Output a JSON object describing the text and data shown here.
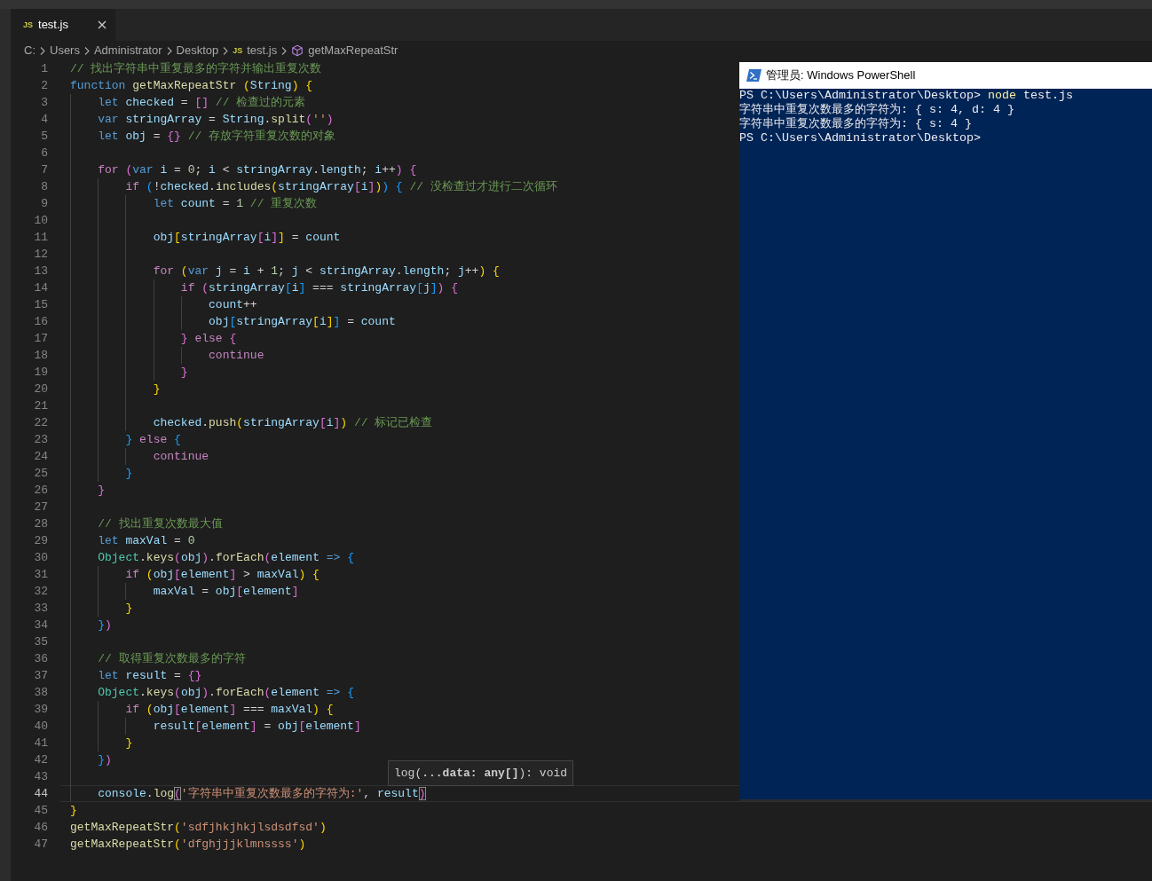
{
  "tabs": [
    {
      "icon_label": "JS",
      "label": "test.js",
      "selected": true
    }
  ],
  "breadcrumbs": [
    {
      "kind": "folder",
      "label": "C:"
    },
    {
      "kind": "folder",
      "label": "Users"
    },
    {
      "kind": "folder",
      "label": "Administrator"
    },
    {
      "kind": "folder",
      "label": "Desktop"
    },
    {
      "kind": "file",
      "icon_label": "JS",
      "label": "test.js"
    },
    {
      "kind": "symbol",
      "label": "getMaxRepeatStr"
    }
  ],
  "editor": {
    "lines": [
      {
        "number": "1",
        "current": false,
        "tokens": [
          {
            "text": "// 找出字符串中重复最多的字符并输出重复次数",
            "kind": "comment"
          }
        ]
      },
      {
        "number": "2",
        "current": false,
        "tokens": [
          {
            "text": "function",
            "kind": "keyword"
          },
          {
            "text": " getMaxRepeatStr",
            "kind": "function"
          },
          {
            "text": " (",
            "kind": "bracket1"
          },
          {
            "text": "String",
            "kind": "variable"
          },
          {
            "text": ")",
            "kind": "bracket1"
          },
          {
            "text": " {",
            "kind": "bracket1"
          }
        ]
      },
      {
        "number": "3",
        "current": false,
        "tokens": [
          {
            "text": "    let",
            "kind": "keyword"
          },
          {
            "text": " checked",
            "kind": "variable"
          },
          {
            "text": " = ",
            "kind": "plain"
          },
          {
            "text": "[]",
            "kind": "bracket2"
          },
          {
            "text": " // 检查过的元素",
            "kind": "comment"
          }
        ]
      },
      {
        "number": "4",
        "current": false,
        "tokens": [
          {
            "text": "    var",
            "kind": "keyword"
          },
          {
            "text": " stringArray",
            "kind": "variable"
          },
          {
            "text": " = ",
            "kind": "plain"
          },
          {
            "text": "String",
            "kind": "variable"
          },
          {
            "text": ".",
            "kind": "plain"
          },
          {
            "text": "split",
            "kind": "function"
          },
          {
            "text": "(",
            "kind": "bracket2"
          },
          {
            "text": "''",
            "kind": "string"
          },
          {
            "text": ")",
            "kind": "bracket2"
          }
        ]
      },
      {
        "number": "5",
        "current": false,
        "tokens": [
          {
            "text": "    let",
            "kind": "keyword"
          },
          {
            "text": " obj",
            "kind": "variable"
          },
          {
            "text": " = ",
            "kind": "plain"
          },
          {
            "text": "{}",
            "kind": "bracket2"
          },
          {
            "text": " // 存放字符重复次数的对象",
            "kind": "comment"
          }
        ]
      },
      {
        "number": "6",
        "current": false
      },
      {
        "number": "7",
        "current": false,
        "tokens": [
          {
            "text": "    for",
            "kind": "control"
          },
          {
            "text": " (",
            "kind": "bracket2"
          },
          {
            "text": "var",
            "kind": "keyword"
          },
          {
            "text": " i",
            "kind": "variable"
          },
          {
            "text": " = ",
            "kind": "plain"
          },
          {
            "text": "0",
            "kind": "number"
          },
          {
            "text": "; ",
            "kind": "plain"
          },
          {
            "text": "i",
            "kind": "variable"
          },
          {
            "text": " < ",
            "kind": "plain"
          },
          {
            "text": "stringArray",
            "kind": "variable"
          },
          {
            "text": ".",
            "kind": "plain"
          },
          {
            "text": "length",
            "kind": "variable"
          },
          {
            "text": "; ",
            "kind": "plain"
          },
          {
            "text": "i",
            "kind": "variable"
          },
          {
            "text": "++",
            "kind": "plain"
          },
          {
            "text": ")",
            "kind": "bracket2"
          },
          {
            "text": " {",
            "kind": "bracket2"
          }
        ]
      },
      {
        "number": "8",
        "current": false,
        "tokens": [
          {
            "text": "        if",
            "kind": "control"
          },
          {
            "text": " (",
            "kind": "bracket3"
          },
          {
            "text": "!",
            "kind": "plain"
          },
          {
            "text": "checked",
            "kind": "variable"
          },
          {
            "text": ".",
            "kind": "plain"
          },
          {
            "text": "includes",
            "kind": "function"
          },
          {
            "text": "(",
            "kind": "bracket1"
          },
          {
            "text": "stringArray",
            "kind": "variable"
          },
          {
            "text": "[",
            "kind": "bracket2"
          },
          {
            "text": "i",
            "kind": "variable"
          },
          {
            "text": "]",
            "kind": "bracket2"
          },
          {
            "text": ")",
            "kind": "bracket1"
          },
          {
            "text": ")",
            "kind": "bracket3"
          },
          {
            "text": " {",
            "kind": "bracket3"
          },
          {
            "text": " // 没检查过才进行二次循环",
            "kind": "comment"
          }
        ]
      },
      {
        "number": "9",
        "current": false,
        "tokens": [
          {
            "text": "            let",
            "kind": "keyword"
          },
          {
            "text": " count",
            "kind": "variable"
          },
          {
            "text": " = ",
            "kind": "plain"
          },
          {
            "text": "1",
            "kind": "number"
          },
          {
            "text": " // 重复次数",
            "kind": "comment"
          }
        ]
      },
      {
        "number": "10",
        "current": false
      },
      {
        "number": "11",
        "current": false,
        "tokens": [
          {
            "text": "            obj",
            "kind": "variable"
          },
          {
            "text": "[",
            "kind": "bracket1"
          },
          {
            "text": "stringArray",
            "kind": "variable"
          },
          {
            "text": "[",
            "kind": "bracket2"
          },
          {
            "text": "i",
            "kind": "variable"
          },
          {
            "text": "]",
            "kind": "bracket2"
          },
          {
            "text": "]",
            "kind": "bracket1"
          },
          {
            "text": " = ",
            "kind": "plain"
          },
          {
            "text": "count",
            "kind": "variable"
          }
        ]
      },
      {
        "number": "12",
        "current": false
      },
      {
        "number": "13",
        "current": false,
        "tokens": [
          {
            "text": "            for",
            "kind": "control"
          },
          {
            "text": " (",
            "kind": "bracket1"
          },
          {
            "text": "var",
            "kind": "keyword"
          },
          {
            "text": " j",
            "kind": "variable"
          },
          {
            "text": " = ",
            "kind": "plain"
          },
          {
            "text": "i",
            "kind": "variable"
          },
          {
            "text": " + ",
            "kind": "plain"
          },
          {
            "text": "1",
            "kind": "number"
          },
          {
            "text": "; ",
            "kind": "plain"
          },
          {
            "text": "j",
            "kind": "variable"
          },
          {
            "text": " < ",
            "kind": "plain"
          },
          {
            "text": "stringArray",
            "kind": "variable"
          },
          {
            "text": ".",
            "kind": "plain"
          },
          {
            "text": "length",
            "kind": "variable"
          },
          {
            "text": "; ",
            "kind": "plain"
          },
          {
            "text": "j",
            "kind": "variable"
          },
          {
            "text": "++",
            "kind": "plain"
          },
          {
            "text": ")",
            "kind": "bracket1"
          },
          {
            "text": " {",
            "kind": "bracket1"
          }
        ]
      },
      {
        "number": "14",
        "current": false,
        "tokens": [
          {
            "text": "                if",
            "kind": "control"
          },
          {
            "text": " (",
            "kind": "bracket2"
          },
          {
            "text": "stringArray",
            "kind": "variable"
          },
          {
            "text": "[",
            "kind": "bracket3"
          },
          {
            "text": "i",
            "kind": "variable"
          },
          {
            "text": "]",
            "kind": "bracket3"
          },
          {
            "text": " === ",
            "kind": "plain"
          },
          {
            "text": "stringArray",
            "kind": "variable"
          },
          {
            "text": "[",
            "kind": "bracket3"
          },
          {
            "text": "j",
            "kind": "variable"
          },
          {
            "text": "]",
            "kind": "bracket3"
          },
          {
            "text": ")",
            "kind": "bracket2"
          },
          {
            "text": " {",
            "kind": "bracket2"
          }
        ]
      },
      {
        "number": "15",
        "current": false,
        "tokens": [
          {
            "text": "                    count",
            "kind": "variable"
          },
          {
            "text": "++",
            "kind": "plain"
          }
        ]
      },
      {
        "number": "16",
        "current": false,
        "tokens": [
          {
            "text": "                    obj",
            "kind": "variable"
          },
          {
            "text": "[",
            "kind": "bracket3"
          },
          {
            "text": "stringArray",
            "kind": "variable"
          },
          {
            "text": "[",
            "kind": "bracket1"
          },
          {
            "text": "i",
            "kind": "variable"
          },
          {
            "text": "]",
            "kind": "bracket1"
          },
          {
            "text": "]",
            "kind": "bracket3"
          },
          {
            "text": " = ",
            "kind": "plain"
          },
          {
            "text": "count",
            "kind": "variable"
          }
        ]
      },
      {
        "number": "17",
        "current": false,
        "tokens": [
          {
            "text": "                }",
            "kind": "bracket2"
          },
          {
            "text": " else",
            "kind": "control"
          },
          {
            "text": " {",
            "kind": "bracket2"
          }
        ]
      },
      {
        "number": "18",
        "current": false,
        "tokens": [
          {
            "text": "                    continue",
            "kind": "control"
          }
        ]
      },
      {
        "number": "19",
        "current": false,
        "tokens": [
          {
            "text": "                }",
            "kind": "bracket2"
          }
        ]
      },
      {
        "number": "20",
        "current": false,
        "tokens": [
          {
            "text": "            }",
            "kind": "bracket1"
          }
        ]
      },
      {
        "number": "21",
        "current": false
      },
      {
        "number": "22",
        "current": false,
        "tokens": [
          {
            "text": "            checked",
            "kind": "variable"
          },
          {
            "text": ".",
            "kind": "plain"
          },
          {
            "text": "push",
            "kind": "function"
          },
          {
            "text": "(",
            "kind": "bracket1"
          },
          {
            "text": "stringArray",
            "kind": "variable"
          },
          {
            "text": "[",
            "kind": "bracket2"
          },
          {
            "text": "i",
            "kind": "variable"
          },
          {
            "text": "]",
            "kind": "bracket2"
          },
          {
            "text": ")",
            "kind": "bracket1"
          },
          {
            "text": " // 标记已检查",
            "kind": "comment"
          }
        ]
      },
      {
        "number": "23",
        "current": false,
        "tokens": [
          {
            "text": "        }",
            "kind": "bracket3"
          },
          {
            "text": " else",
            "kind": "control"
          },
          {
            "text": " {",
            "kind": "bracket3"
          }
        ]
      },
      {
        "number": "24",
        "current": false,
        "tokens": [
          {
            "text": "            continue",
            "kind": "control"
          }
        ]
      },
      {
        "number": "25",
        "current": false,
        "tokens": [
          {
            "text": "        }",
            "kind": "bracket3"
          }
        ]
      },
      {
        "number": "26",
        "current": false,
        "tokens": [
          {
            "text": "    }",
            "kind": "bracket2"
          }
        ]
      },
      {
        "number": "27",
        "current": false
      },
      {
        "number": "28",
        "current": false,
        "tokens": [
          {
            "text": "    // 找出重复次数最大值",
            "kind": "comment"
          }
        ]
      },
      {
        "number": "29",
        "current": false,
        "tokens": [
          {
            "text": "    let",
            "kind": "keyword"
          },
          {
            "text": " maxVal",
            "kind": "variable"
          },
          {
            "text": " = ",
            "kind": "plain"
          },
          {
            "text": "0",
            "kind": "number"
          }
        ]
      },
      {
        "number": "30",
        "current": false,
        "tokens": [
          {
            "text": "    Object",
            "kind": "type"
          },
          {
            "text": ".",
            "kind": "plain"
          },
          {
            "text": "keys",
            "kind": "function"
          },
          {
            "text": "(",
            "kind": "bracket2"
          },
          {
            "text": "obj",
            "kind": "variable"
          },
          {
            "text": ")",
            "kind": "bracket2"
          },
          {
            "text": ".",
            "kind": "plain"
          },
          {
            "text": "forEach",
            "kind": "function"
          },
          {
            "text": "(",
            "kind": "bracket2"
          },
          {
            "text": "element",
            "kind": "variable"
          },
          {
            "text": " =>",
            "kind": "keyword"
          },
          {
            "text": " {",
            "kind": "bracket3"
          }
        ]
      },
      {
        "number": "31",
        "current": false,
        "tokens": [
          {
            "text": "        if",
            "kind": "control"
          },
          {
            "text": " (",
            "kind": "bracket1"
          },
          {
            "text": "obj",
            "kind": "variable"
          },
          {
            "text": "[",
            "kind": "bracket2"
          },
          {
            "text": "element",
            "kind": "variable"
          },
          {
            "text": "]",
            "kind": "bracket2"
          },
          {
            "text": " > ",
            "kind": "plain"
          },
          {
            "text": "maxVal",
            "kind": "variable"
          },
          {
            "text": ")",
            "kind": "bracket1"
          },
          {
            "text": " {",
            "kind": "bracket1"
          }
        ]
      },
      {
        "number": "32",
        "current": false,
        "tokens": [
          {
            "text": "            maxVal",
            "kind": "variable"
          },
          {
            "text": " = ",
            "kind": "plain"
          },
          {
            "text": "obj",
            "kind": "variable"
          },
          {
            "text": "[",
            "kind": "bracket2"
          },
          {
            "text": "element",
            "kind": "variable"
          },
          {
            "text": "]",
            "kind": "bracket2"
          }
        ]
      },
      {
        "number": "33",
        "current": false,
        "tokens": [
          {
            "text": "        }",
            "kind": "bracket1"
          }
        ]
      },
      {
        "number": "34",
        "current": false,
        "tokens": [
          {
            "text": "    }",
            "kind": "bracket3"
          },
          {
            "text": ")",
            "kind": "bracket2"
          }
        ]
      },
      {
        "number": "35",
        "current": false
      },
      {
        "number": "36",
        "current": false,
        "tokens": [
          {
            "text": "    // 取得重复次数最多的字符",
            "kind": "comment"
          }
        ]
      },
      {
        "number": "37",
        "current": false,
        "tokens": [
          {
            "text": "    let",
            "kind": "keyword"
          },
          {
            "text": " result",
            "kind": "variable"
          },
          {
            "text": " = ",
            "kind": "plain"
          },
          {
            "text": "{}",
            "kind": "bracket2"
          }
        ]
      },
      {
        "number": "38",
        "current": false,
        "tokens": [
          {
            "text": "    Object",
            "kind": "type"
          },
          {
            "text": ".",
            "kind": "plain"
          },
          {
            "text": "keys",
            "kind": "function"
          },
          {
            "text": "(",
            "kind": "bracket2"
          },
          {
            "text": "obj",
            "kind": "variable"
          },
          {
            "text": ")",
            "kind": "bracket2"
          },
          {
            "text": ".",
            "kind": "plain"
          },
          {
            "text": "forEach",
            "kind": "function"
          },
          {
            "text": "(",
            "kind": "bracket2"
          },
          {
            "text": "element",
            "kind": "variable"
          },
          {
            "text": " =>",
            "kind": "keyword"
          },
          {
            "text": " {",
            "kind": "bracket3"
          }
        ]
      },
      {
        "number": "39",
        "current": false,
        "tokens": [
          {
            "text": "        if",
            "kind": "control"
          },
          {
            "text": " (",
            "kind": "bracket1"
          },
          {
            "text": "obj",
            "kind": "variable"
          },
          {
            "text": "[",
            "kind": "bracket2"
          },
          {
            "text": "element",
            "kind": "variable"
          },
          {
            "text": "]",
            "kind": "bracket2"
          },
          {
            "text": " === ",
            "kind": "plain"
          },
          {
            "text": "maxVal",
            "kind": "variable"
          },
          {
            "text": ")",
            "kind": "bracket1"
          },
          {
            "text": " {",
            "kind": "bracket1"
          }
        ]
      },
      {
        "number": "40",
        "current": false,
        "tokens": [
          {
            "text": "            result",
            "kind": "variable"
          },
          {
            "text": "[",
            "kind": "bracket2"
          },
          {
            "text": "element",
            "kind": "variable"
          },
          {
            "text": "]",
            "kind": "bracket2"
          },
          {
            "text": " = ",
            "kind": "plain"
          },
          {
            "text": "obj",
            "kind": "variable"
          },
          {
            "text": "[",
            "kind": "bracket2"
          },
          {
            "text": "element",
            "kind": "variable"
          },
          {
            "text": "]",
            "kind": "bracket2"
          }
        ]
      },
      {
        "number": "41",
        "current": false,
        "tokens": [
          {
            "text": "        }",
            "kind": "bracket1"
          }
        ]
      },
      {
        "number": "42",
        "current": false,
        "tokens": [
          {
            "text": "    }",
            "kind": "bracket3"
          },
          {
            "text": ")",
            "kind": "bracket2"
          }
        ]
      },
      {
        "number": "43",
        "current": false
      },
      {
        "number": "44",
        "current": true,
        "tokens": [
          {
            "text": "    console",
            "kind": "variable"
          },
          {
            "text": ".",
            "kind": "plain"
          },
          {
            "text": "log",
            "kind": "function"
          },
          {
            "text": "(",
            "kind": "matched"
          },
          {
            "text": "'字符串中重复次数最多的字符为:'",
            "kind": "string"
          },
          {
            "text": ", ",
            "kind": "plain"
          },
          {
            "text": "result",
            "kind": "variable"
          },
          {
            "text": ")",
            "kind": "matched"
          }
        ]
      },
      {
        "number": "45",
        "current": false,
        "tokens": [
          {
            "text": "}",
            "kind": "bracket1"
          }
        ]
      },
      {
        "number": "46",
        "current": false,
        "tokens": [
          {
            "text": "getMaxRepeatStr",
            "kind": "function"
          },
          {
            "text": "(",
            "kind": "bracket1"
          },
          {
            "text": "'sdfjhkjhkjlsdsdfsd'",
            "kind": "string"
          },
          {
            "text": ")",
            "kind": "bracket1"
          }
        ]
      },
      {
        "number": "47",
        "current": false,
        "tokens": [
          {
            "text": "getMaxRepeatStr",
            "kind": "function"
          },
          {
            "text": "(",
            "kind": "bracket1"
          },
          {
            "text": "'dfghjjjklmnssss'",
            "kind": "string"
          },
          {
            "text": ")",
            "kind": "bracket1"
          }
        ]
      }
    ],
    "parameter_hint": "log(**...data: any[]**): void"
  },
  "terminal_window": {
    "title": "管理员: Windows PowerShell",
    "lines": [
      {
        "segments": [
          {
            "text": "PS C:\\Users\\Administrator\\Desktop>",
            "kind": "prompt"
          },
          {
            "text": " node",
            "kind": "command"
          },
          {
            "text": " test.js",
            "kind": "argument"
          }
        ]
      },
      {
        "segments": [
          {
            "text": "字符串中重复次数最多的字符为: { s: 4, d: 4 }",
            "kind": "output"
          }
        ]
      },
      {
        "segments": [
          {
            "text": "字符串中重复次数最多的字符为: { s: 4 }",
            "kind": "output"
          }
        ]
      },
      {
        "segments": [
          {
            "text": "PS C:\\Users\\Administrator\\Desktop>",
            "kind": "prompt"
          }
        ]
      }
    ]
  }
}
